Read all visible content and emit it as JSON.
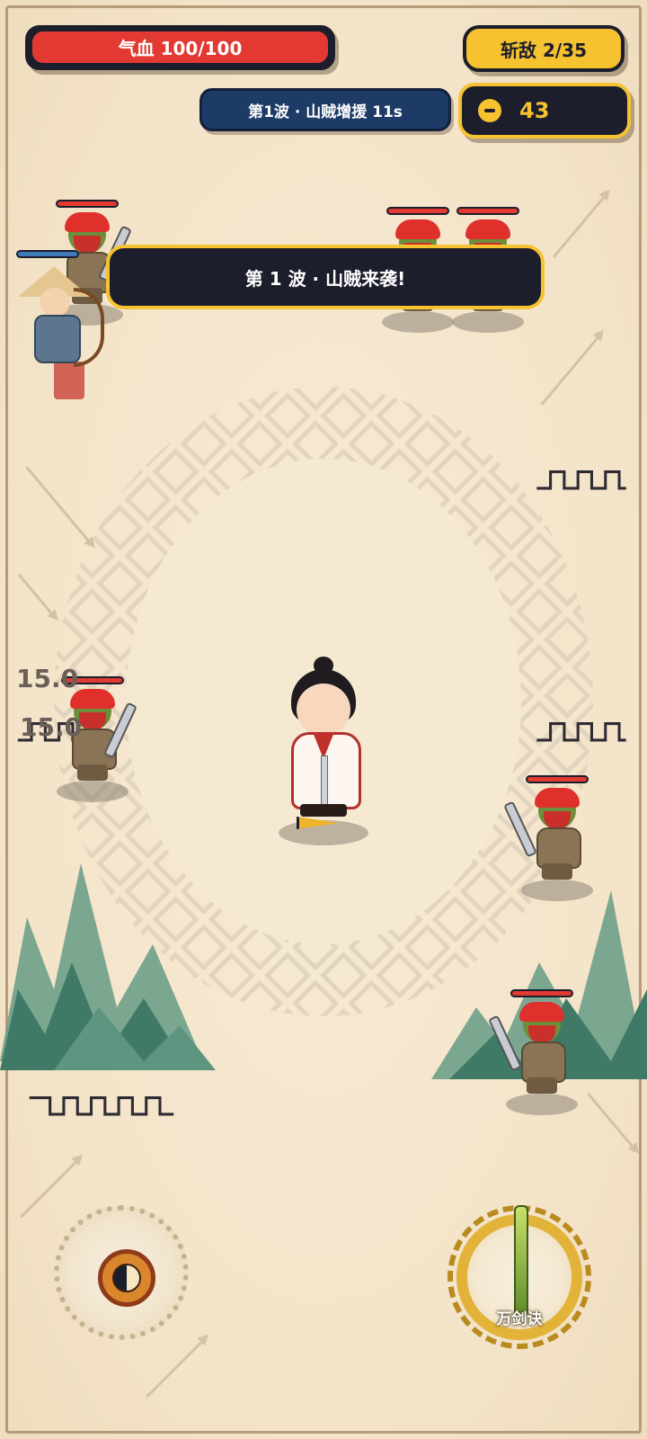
{
  "hud": {
    "hp_label": "气血 100/100",
    "kills_label": "斩敌 2/35",
    "wave_info": "第1波 · 山贼增援 11s",
    "coins": "43",
    "hp_ratio": 1.0
  },
  "banner": {
    "text": "第 1 波 · 山贼来袭!"
  },
  "damage_numbers": [
    "15.0",
    "15.0"
  ],
  "skills": {
    "left": {
      "icon": "bagua-icon"
    },
    "right": {
      "icon": "jade-sword-icon",
      "label": "万剑诀"
    }
  },
  "colors": {
    "hp": "#e23a33",
    "gold": "#f6c230",
    "dark": "#1c1e2c",
    "wave_bg": "#1d3b66",
    "parchment": "#f5e7cf"
  }
}
